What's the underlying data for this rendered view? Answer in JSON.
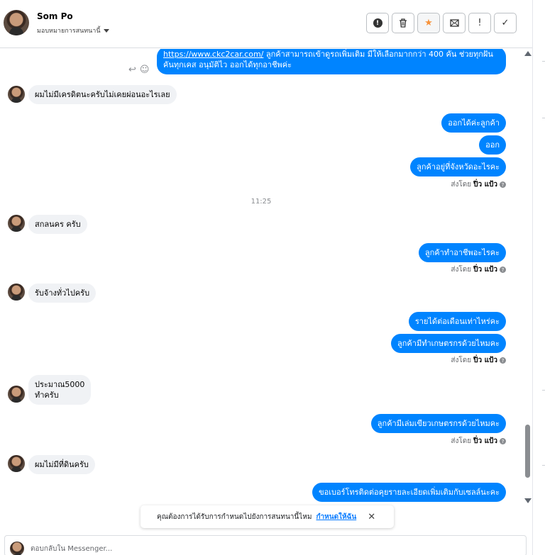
{
  "header": {
    "contact_name": "Som Po",
    "assign_label": "มอบหมายการสนทนานี้",
    "actions": [
      {
        "name": "spam-button",
        "icon": "!"
      },
      {
        "name": "delete-button",
        "icon": "🗑"
      },
      {
        "name": "star-button",
        "icon": "★"
      },
      {
        "name": "mark-unread-button",
        "icon": "✉"
      },
      {
        "name": "follow-up-button",
        "icon": "!"
      },
      {
        "name": "done-button",
        "icon": "✓"
      }
    ]
  },
  "messages": {
    "m0_link": "https://www.ckc2car.com/",
    "m0_text_a": " ลูกค้าสามารถเข้าดูรถเพิ่มเติม มีให้เลือกมากกว่า 400 คัน ช่วยทุกฝัน",
    "m0_text_b": "คันทุกเคส อนุมัติไว ออกได้ทุกอาชีพค่ะ",
    "m1": "ผมไม่มีเครดิตนะครับไม่เคยผ่อนอะไรเลย",
    "m2": "ออกได้ค่ะลูกค้า",
    "m3": "ออก",
    "m4": "ลูกค้าอยู่ที่จังหวัดอะไรคะ",
    "time1": "11:25",
    "m5": "สกลนคร ครับ",
    "m6": "ลูกค้าทำอาชีพอะไรคะ",
    "m7": "รับจ้างทั่วไปครับ",
    "m8": "รายได้ต่อเดือนเท่าไหร่คะ",
    "m9": "ลูกค้ามีทำเกษตรกรด้วยไหมคะ",
    "m10_a": "ประมาณ5000",
    "m10_b": "ทำครับ",
    "m11": "ลูกค้ามีเล่มเขียวเกษตรกรด้วยไหมคะ",
    "m12": "ผมไม่มีที่ดินครับ",
    "m13": "ขอเบอร์โทรติดต่อคุยรายละเอียดเพิ่มเติมกับเซลล์นะคะ"
  },
  "sent_by": {
    "prefix": "ส่งโดย",
    "agent": "ปิ่ว แป้ว"
  },
  "toast": {
    "text": "คุณต้องการได้รับการกำหนดไปยังการสนทนานี้ไหม",
    "link": "กำหนดให้ฉัน",
    "close": "✕"
  },
  "composer": {
    "placeholder": "ตอบกลับใน Messenger..."
  },
  "colors": {
    "outgoing_bubble": "#0084ff",
    "incoming_bubble": "#f0f2f5",
    "star": "#f7923a"
  }
}
